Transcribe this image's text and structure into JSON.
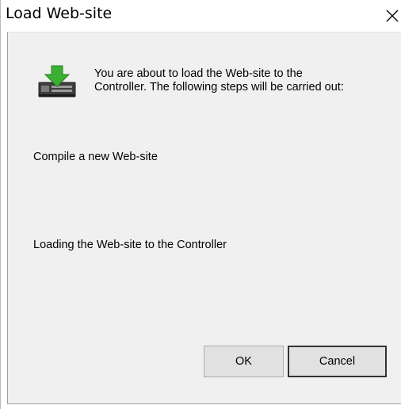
{
  "window": {
    "title": "Load Web-site",
    "close_icon": "close-icon"
  },
  "message": {
    "icon": "download-arrow-controller-icon",
    "line1": "You are about to load the Web-site to the",
    "line2": "Controller. The following steps will be carried out:"
  },
  "steps": [
    "Compile a new Web-site",
    "Loading the Web-site to the Controller"
  ],
  "buttons": {
    "ok_label": "OK",
    "cancel_label": "Cancel"
  },
  "colors": {
    "client_background": "#f0f0f0",
    "button_face": "#e1e1e1",
    "icon_green": "#3cb035"
  }
}
